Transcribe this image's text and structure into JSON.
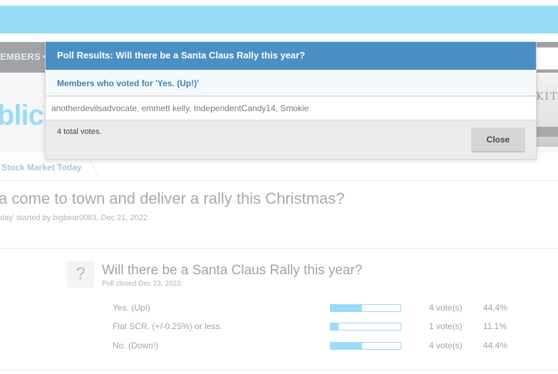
{
  "nav": {
    "members_label": "EMBERS"
  },
  "hero": {
    "logo_text": "blics",
    "image_text": "KITCH"
  },
  "breadcrumb": {
    "item_label": "Stock Market Today"
  },
  "thread": {
    "title": "a come to town and deliver a rally this Christmas?",
    "meta": "day' started by bigbear0083, Dec 21, 2022."
  },
  "poll": {
    "icon_glyph": "?",
    "question": "Will there be a Santa Claus Rally this year?",
    "status": "Poll closed Dec 23, 2022.",
    "options": [
      {
        "label": "Yes. (Up!)",
        "fraction": 0.444,
        "votes": "4 vote(s)",
        "percent": "44.4%"
      },
      {
        "label": "Flat SCR. (+/-0.25%) or less.",
        "fraction": 0.111,
        "votes": "1 vote(s)",
        "percent": "11.1%"
      },
      {
        "label": "No. (Down!)",
        "fraction": 0.444,
        "votes": "4 vote(s)",
        "percent": "44.4%"
      }
    ]
  },
  "modal": {
    "title": "Poll Results: Will there be a Santa Claus Rally this year?",
    "subtitle": "Members who voted for 'Yes. (Up!)'",
    "voters": "anotherdevilsadvocate, emmett kelly, IndependentCandy14, Smokie",
    "total": "4 total votes.",
    "close_label": "Close"
  },
  "colors": {
    "accent": "#4a90c4",
    "bar_fill": "#9adbf5",
    "banner": "#9adbf5",
    "nav": "#9fa3a6"
  }
}
